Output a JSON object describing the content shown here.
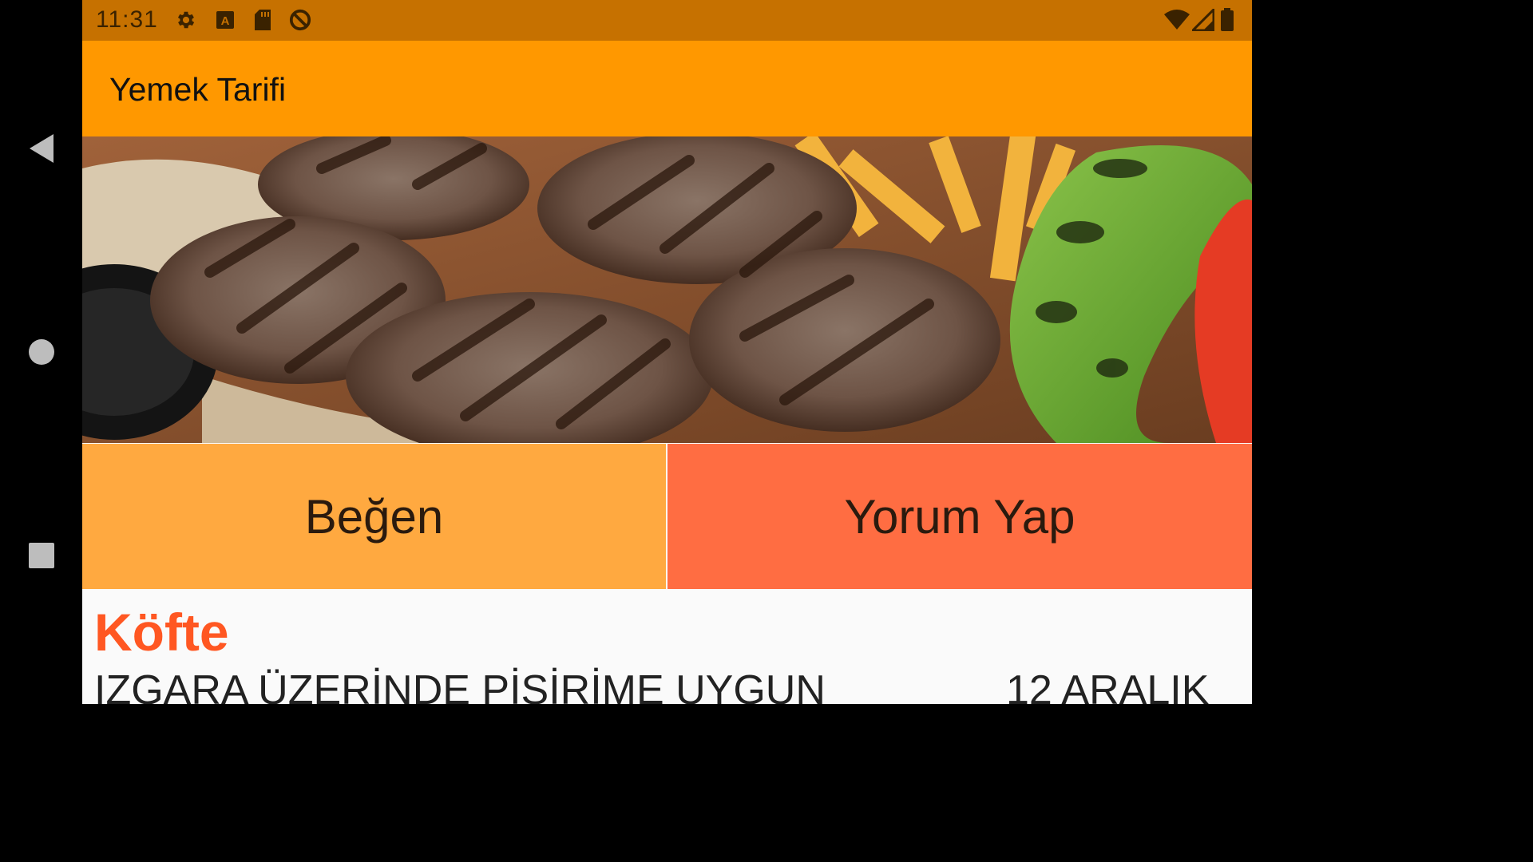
{
  "status_bar": {
    "time": "11:31",
    "left_icons": [
      "gear-icon",
      "a-box-icon",
      "sd-card-icon",
      "no-sync-icon"
    ],
    "right_icons": [
      "wifi-icon",
      "signal-icon",
      "battery-icon"
    ]
  },
  "toolbar": {
    "title": "Yemek Tarifi"
  },
  "hero": {
    "alt": "Köfte"
  },
  "actions": {
    "like_label": "Beğen",
    "comment_label": "Yorum Yap"
  },
  "recipe": {
    "name": "Köfte",
    "description": "IZGARA ÜZERİNDE PİŞİRİME UYGUN",
    "date": "12 ARALIK"
  },
  "colors": {
    "status_bar": "#c67100",
    "toolbar": "#ff9800",
    "like_button": "#ffa940",
    "comment_button": "#ff6d42",
    "recipe_name": "#ff5722"
  }
}
